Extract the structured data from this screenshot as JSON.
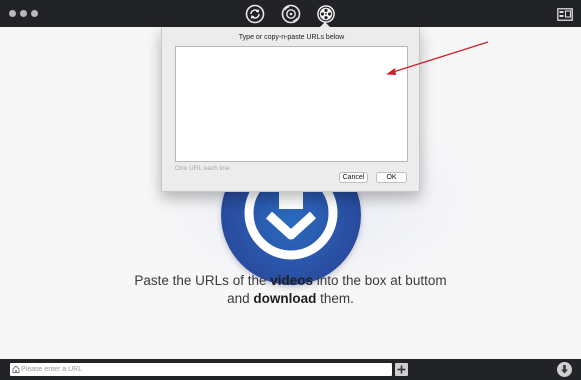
{
  "titlebar": {
    "traffic_lights": [
      "close",
      "minimize",
      "zoom"
    ],
    "tabs": [
      {
        "icon": "refresh-icon",
        "active": false
      },
      {
        "icon": "film-reel-icon",
        "active": false
      },
      {
        "icon": "download-reel-icon",
        "active": true
      }
    ],
    "right_icon": "window-layout-icon"
  },
  "dialog": {
    "title": "Type or copy-n-paste URLs below",
    "textarea_value": "",
    "hint": "One URL each line",
    "cancel_label": "Cancel",
    "ok_label": "OK"
  },
  "main": {
    "headline_part1": "Paste the URLs of the ",
    "headline_bold1": "videos",
    "headline_part2": " into the box at buttom",
    "headline_part3": "and ",
    "headline_bold2": "download",
    "headline_part4": " them."
  },
  "bottombar": {
    "url_placeholder": "Please enter a URL",
    "url_value": ""
  },
  "colors": {
    "titlebar": "#222327",
    "annotation_arrow": "#d0202a",
    "logo_blue": "#2a4fa3"
  }
}
